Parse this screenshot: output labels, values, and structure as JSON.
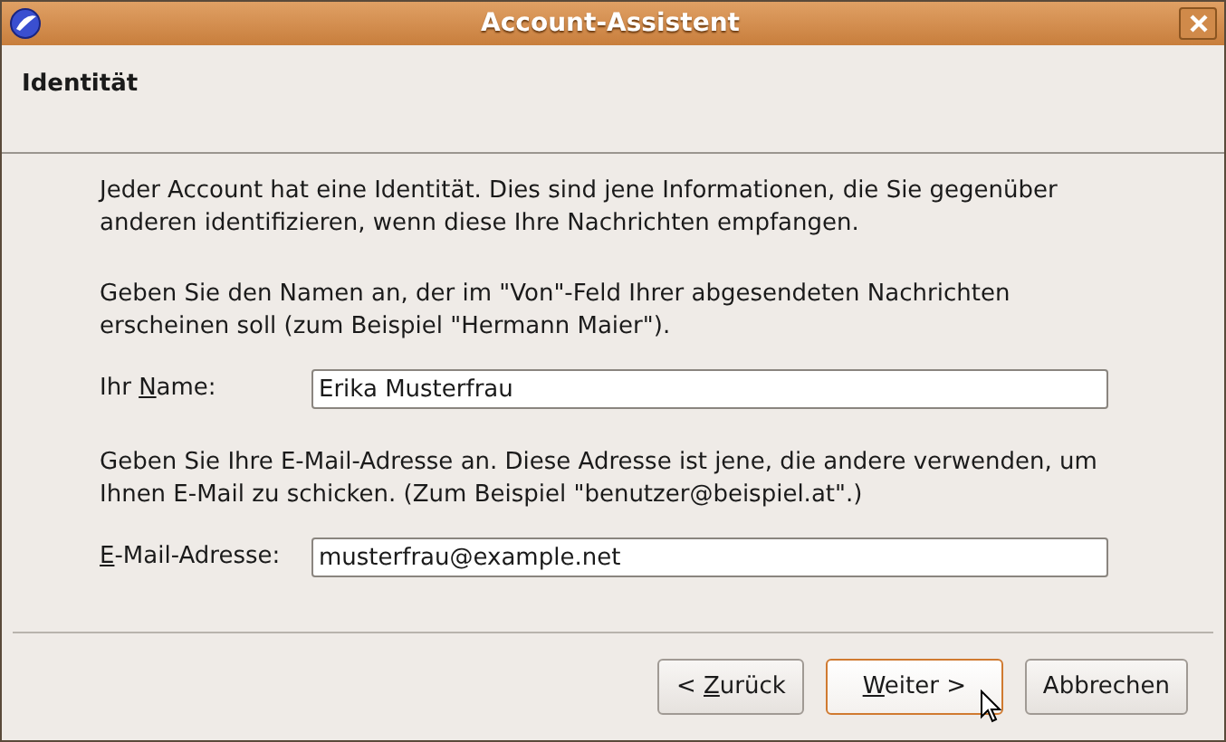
{
  "window": {
    "title": "Account-Assistent"
  },
  "page": {
    "title": "Identität"
  },
  "intro": "Jeder Account hat eine Identität. Dies sind jene Informationen, die Sie gegenüber anderen identifizieren, wenn diese Ihre Nachrichten empfangen.",
  "sections": [
    {
      "hint": "Geben Sie den Namen an, der im \"Von\"-Feld Ihrer abgesendeten Nachrichten erscheinen soll (zum Beispiel \"Hermann Maier\").",
      "label": {
        "before": "Ihr ",
        "key": "N",
        "after": "ame:"
      },
      "value": "Erika Musterfrau"
    },
    {
      "hint": "Geben Sie Ihre E-Mail-Adresse an. Diese Adresse ist jene, die andere verwenden, um Ihnen E-Mail zu schicken. (Zum Beispiel \"benutzer@beispiel.at\".)",
      "label": {
        "key": "E",
        "after": "-Mail-Adresse:"
      },
      "value": "musterfrau@example.net"
    }
  ],
  "buttons": [
    {
      "before": "< ",
      "key": "Z",
      "after": "urück",
      "focused": false,
      "hovered": false
    },
    {
      "key": "W",
      "after": "eiter >",
      "focused": true,
      "hovered": true
    },
    {
      "before": "Abbrechen",
      "focused": false,
      "hovered": false
    }
  ]
}
